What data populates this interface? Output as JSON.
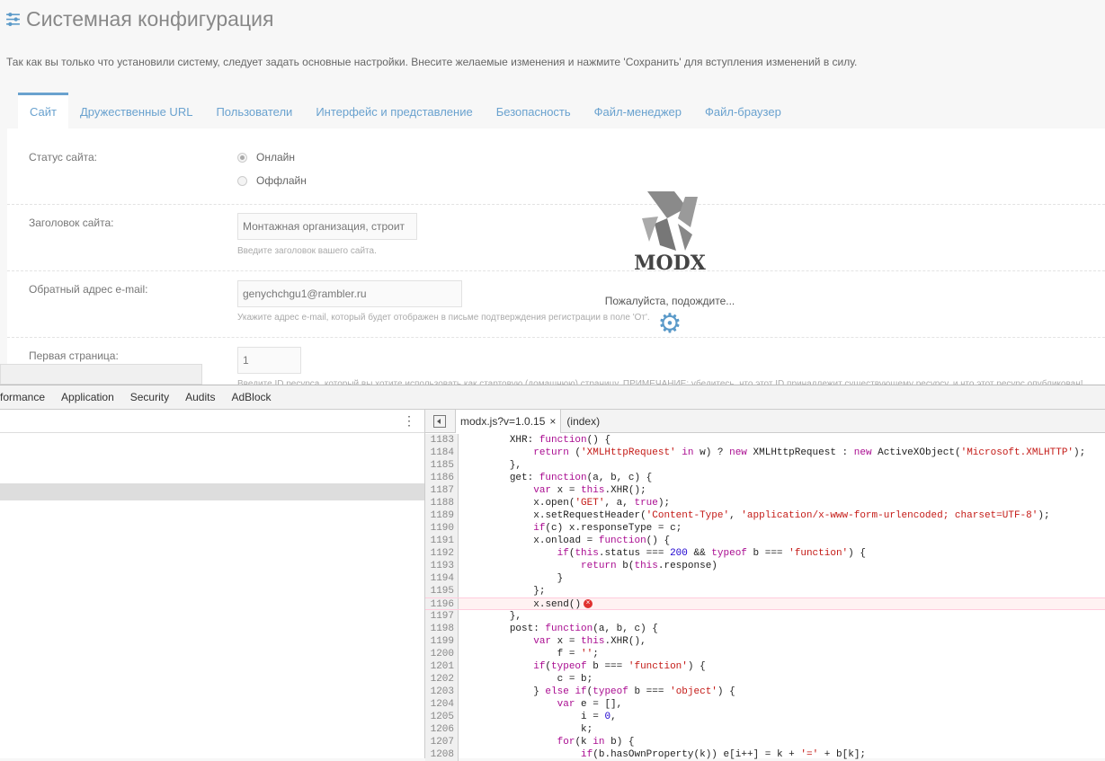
{
  "header": {
    "title": "Системная конфигурация",
    "intro": "Так как вы только что установили систему, следует задать основные настройки. Внесите желаемые изменения и нажмите 'Сохранить' для вступления изменений в силу."
  },
  "tabs": [
    "Сайт",
    "Дружественные URL",
    "Пользователи",
    "Интерфейс и представление",
    "Безопасность",
    "Файл-менеджер",
    "Файл-браузер"
  ],
  "form": {
    "status_label": "Статус сайта:",
    "online": "Онлайн",
    "offline": "Оффлайн",
    "site_name_label": "Заголовок сайта:",
    "site_name_value": "Монтажная организация, строит",
    "site_name_help": "Введите заголовок вашего сайта.",
    "email_label": "Обратный адрес e-mail:",
    "email_value": "genychchgu1@rambler.ru",
    "email_help": "Укажите адрес e-mail, который будет отображен в письме подтверждения регистрации в поле 'От'.",
    "start_label": "Первая страница:",
    "start_value": "1",
    "start_help": "Введите ID ресурса, который вы хотите использовать как стартовую (домашнюю) страницу. ПРИМЕЧАНИЕ: убедитесь, что этот ID принадлежит существующему ресурсу, и что этот ресурс опубликован!"
  },
  "loader": {
    "logo": "MODX",
    "wait": "Пожалуйста, подождите..."
  },
  "devtools": {
    "tabs": [
      "formance",
      "Application",
      "Security",
      "Audits",
      "AdBlock"
    ],
    "file_tab": "modx.js?v=1.0.15",
    "close": "×",
    "index_tab": "(index)",
    "error_line": 1196,
    "lines": [
      {
        "n": "1183",
        "t": "        XHR: function() {"
      },
      {
        "n": "1184",
        "t": "            return ('XMLHttpRequest' in w) ? new XMLHttpRequest : new ActiveXObject('Microsoft.XMLHTTP');"
      },
      {
        "n": "1185",
        "t": "        },"
      },
      {
        "n": "1186",
        "t": "        get: function(a, b, c) {"
      },
      {
        "n": "1187",
        "t": "            var x = this.XHR();"
      },
      {
        "n": "1188",
        "t": "            x.open('GET', a, true);"
      },
      {
        "n": "1189",
        "t": "            x.setRequestHeader('Content-Type', 'application/x-www-form-urlencoded; charset=UTF-8');"
      },
      {
        "n": "1190",
        "t": "            if(c) x.responseType = c;"
      },
      {
        "n": "1191",
        "t": "            x.onload = function() {"
      },
      {
        "n": "1192",
        "t": "                if(this.status === 200 && typeof b === 'function') {"
      },
      {
        "n": "1193",
        "t": "                    return b(this.response)"
      },
      {
        "n": "1194",
        "t": "                }"
      },
      {
        "n": "1195",
        "t": "            };"
      },
      {
        "n": "1196",
        "t": "            x.send()"
      },
      {
        "n": "1197",
        "t": "        },"
      },
      {
        "n": "1198",
        "t": "        post: function(a, b, c) {"
      },
      {
        "n": "1199",
        "t": "            var x = this.XHR(),"
      },
      {
        "n": "1200",
        "t": "                f = '';"
      },
      {
        "n": "1201",
        "t": "            if(typeof b === 'function') {"
      },
      {
        "n": "1202",
        "t": "                c = b;"
      },
      {
        "n": "1203",
        "t": "            } else if(typeof b === 'object') {"
      },
      {
        "n": "1204",
        "t": "                var e = [],"
      },
      {
        "n": "1205",
        "t": "                    i = 0,"
      },
      {
        "n": "1206",
        "t": "                    k;"
      },
      {
        "n": "1207",
        "t": "                for(k in b) {"
      },
      {
        "n": "1208",
        "t": "                    if(b.hasOwnProperty(k)) e[i++] = k + '=' + b[k];"
      }
    ]
  }
}
